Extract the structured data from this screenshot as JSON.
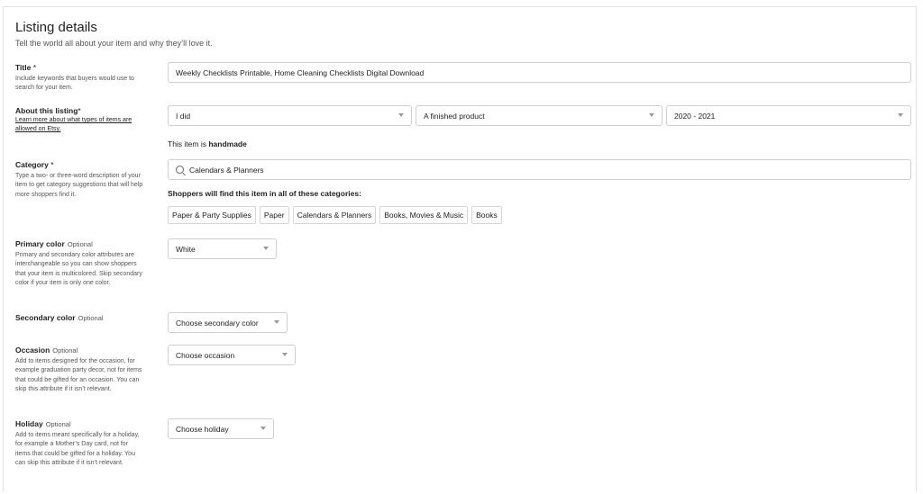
{
  "header": {
    "title": "Listing details",
    "subtitle": "Tell the world all about your item and why they’ll love it."
  },
  "title_field": {
    "label": "Title",
    "required_mark": " *",
    "help": "Include keywords that buyers would use to search for your item.",
    "value": "Weekly Checklists Printable, Home Cleaning Checklists  Digital Download"
  },
  "about": {
    "label": "About this listing",
    "required_mark": "*",
    "help_link": "Learn more about what types of items are allowed on Etsy.",
    "who_made": "I did",
    "what_is_it": "A finished product",
    "when_made": "2020 - 2021",
    "handmade_prefix": "This item is ",
    "handmade_value": "handmade"
  },
  "category": {
    "label": "Category",
    "required_mark": " *",
    "help": "Type a two- or three-word description of your item to get category suggestions that will help more shoppers find it.",
    "value": "Calendars & Planners",
    "search_icon": "search-icon",
    "shoppers_heading": "Shoppers will find this item in all of these categories:",
    "chips": [
      "Paper & Party Supplies",
      "Paper",
      "Calendars & Planners",
      "Books, Movies & Music",
      "Books"
    ]
  },
  "primary_color": {
    "label": "Primary color",
    "optional": "Optional",
    "help": "Primary and secondary color attributes are interchangeable so you can show shoppers that your item is multicolored. Skip secondary color if your item is only one color.",
    "value": "White"
  },
  "secondary_color": {
    "label": "Secondary color",
    "optional": "Optional",
    "value": "Choose secondary color"
  },
  "occasion": {
    "label": "Occasion",
    "optional": "Optional",
    "help": "Add to items designed for the occasion, for example graduation party decor, not for items that could be gifted for an occasion. You can skip this attribute if it isn’t relevant.",
    "value": "Choose occasion"
  },
  "holiday": {
    "label": "Holiday",
    "optional": "Optional",
    "help": "Add to items meant specifically for a holiday, for example a Mother’s Day card, not for items that could be gifted for a holiday. You can skip this attribute if it isn’t relevant.",
    "value": "Choose holiday"
  }
}
